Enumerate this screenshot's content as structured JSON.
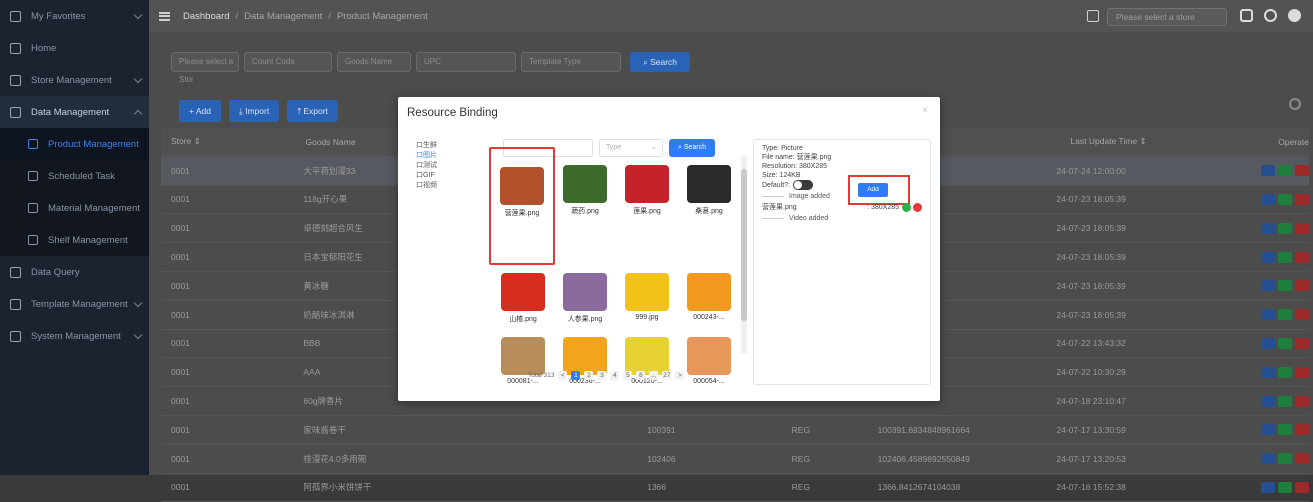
{
  "sidebar": {
    "items": [
      {
        "label": "My Favorites",
        "icon": "star-icon"
      },
      {
        "label": "Home",
        "icon": "home-icon"
      },
      {
        "label": "Store Management",
        "icon": "store-icon"
      },
      {
        "label": "Data Management",
        "icon": "database-icon"
      },
      {
        "label": "Product Management",
        "icon": "cart-icon"
      },
      {
        "label": "Scheduled Task",
        "icon": "clock-icon"
      },
      {
        "label": "Material Management",
        "icon": "image-icon"
      },
      {
        "label": "Shelf Management",
        "icon": "shelf-icon"
      },
      {
        "label": "Data Query",
        "icon": "search-icon"
      },
      {
        "label": "Template Management",
        "icon": "template-icon"
      },
      {
        "label": "System Management",
        "icon": "gear-icon"
      }
    ]
  },
  "topbar": {
    "crumb1": "Dashboard",
    "crumb2": "Data Management",
    "crumb3": "Product Management",
    "store_placeholder": "Please select a store"
  },
  "filters": {
    "store": "Please select a Stor",
    "count_code": "Count Code",
    "goods_name": "Goods Name",
    "upc": "UPC",
    "template_type": "Template Type",
    "search": "Search"
  },
  "actions": {
    "add": "+ Add",
    "import": "Import",
    "export": "Export"
  },
  "table": {
    "headers": {
      "store": "Store",
      "goods": "Goods Name",
      "time": "Last Update Time",
      "op": "Operate"
    },
    "rows": [
      {
        "store": "0001",
        "goods": "大平荷划漫33",
        "code": "",
        "type": "",
        "img": "",
        "time": "24-07-24 12:00:00"
      },
      {
        "store": "0001",
        "goods": "118g开心果",
        "code": "",
        "type": "",
        "img": "",
        "time": "24-07-23 18:05:39"
      },
      {
        "store": "0001",
        "goods": "卓德刻超合风生",
        "code": "",
        "type": "",
        "img": "",
        "time": "24-07-23 18:05:39"
      },
      {
        "store": "0001",
        "goods": "日本宝郁阳花生",
        "code": "",
        "type": "",
        "img": "",
        "time": "24-07-23 18:05:39"
      },
      {
        "store": "0001",
        "goods": "黄冰糖",
        "code": "",
        "type": "",
        "img": "",
        "time": "24-07-23 18:05:39"
      },
      {
        "store": "0001",
        "goods": "奶酪味冰淇淋",
        "code": "",
        "type": "",
        "img": "",
        "time": "24-07-23 18:05:39"
      },
      {
        "store": "0001",
        "goods": "BBB",
        "code": "",
        "type": "",
        "img": "",
        "time": "24-07-22 13:43:32"
      },
      {
        "store": "0001",
        "goods": "AAA",
        "code": "",
        "type": "",
        "img": "",
        "time": "24-07-22 10:30:29"
      },
      {
        "store": "0001",
        "goods": "60g牌香片",
        "code": "",
        "type": "",
        "img": "",
        "time": "24-07-18 23:10:47"
      },
      {
        "store": "0001",
        "goods": "家味酱卷干",
        "code": "100391",
        "type": "REG",
        "img": "100391,6934848961664",
        "time": "24-07-17 13:30:59"
      },
      {
        "store": "0001",
        "goods": "桂漫花4.0多用碗",
        "code": "102406",
        "type": "REG",
        "img": "102406,4589892550849",
        "time": "24-07-17 13:20:53"
      },
      {
        "store": "0001",
        "goods": "阿孤界小米饼饼干",
        "code": "1366",
        "type": "REG",
        "img": "1366,8412674104038",
        "time": "24-07-16 15:52:38"
      }
    ]
  },
  "modal": {
    "title": "Resource Binding",
    "close": "×",
    "tree": [
      "口生鲜",
      "口图片",
      "口测试",
      "口GIF",
      "口视频"
    ],
    "type_placeholder": "Type",
    "search": "Search",
    "images": [
      {
        "name": "营莲果.png",
        "color": "#b0512c"
      },
      {
        "name": "蔬药.png",
        "color": "#3f6a2e"
      },
      {
        "name": "莲果.png",
        "color": "#c4232b"
      },
      {
        "name": "桑葚.png",
        "color": "#2a2a2a"
      },
      {
        "name": "山楂.png",
        "color": "#d62d20"
      },
      {
        "name": "人参果.png",
        "color": "#8b6a9e"
      },
      {
        "name": "999.jpg",
        "color": "#f2c21b"
      },
      {
        "name": "000243-...",
        "color": "#f29a1d"
      },
      {
        "name": "000081-...",
        "color": "#b98c5c"
      },
      {
        "name": "000236-...",
        "color": "#f0a51c"
      },
      {
        "name": "000120-...",
        "color": "#e6d230"
      },
      {
        "name": "000054-...",
        "color": "#e8975a"
      }
    ],
    "pager": {
      "total": "Total 313",
      "pages": [
        "1",
        "2",
        "3",
        "4",
        "5",
        "6",
        "...",
        "27",
        ">"
      ],
      "prev": "<"
    },
    "info": {
      "type": "Type: Picture",
      "file": "File name: 营莲果.png",
      "res": "Resolution: 380X285",
      "size": "Size: 124KB",
      "default": "Default?:",
      "add": "Add",
      "image_added": "Image added",
      "file_row_name": "营莲果.png",
      "file_row_res": ": 380X285",
      "video_added": "Video added"
    }
  }
}
